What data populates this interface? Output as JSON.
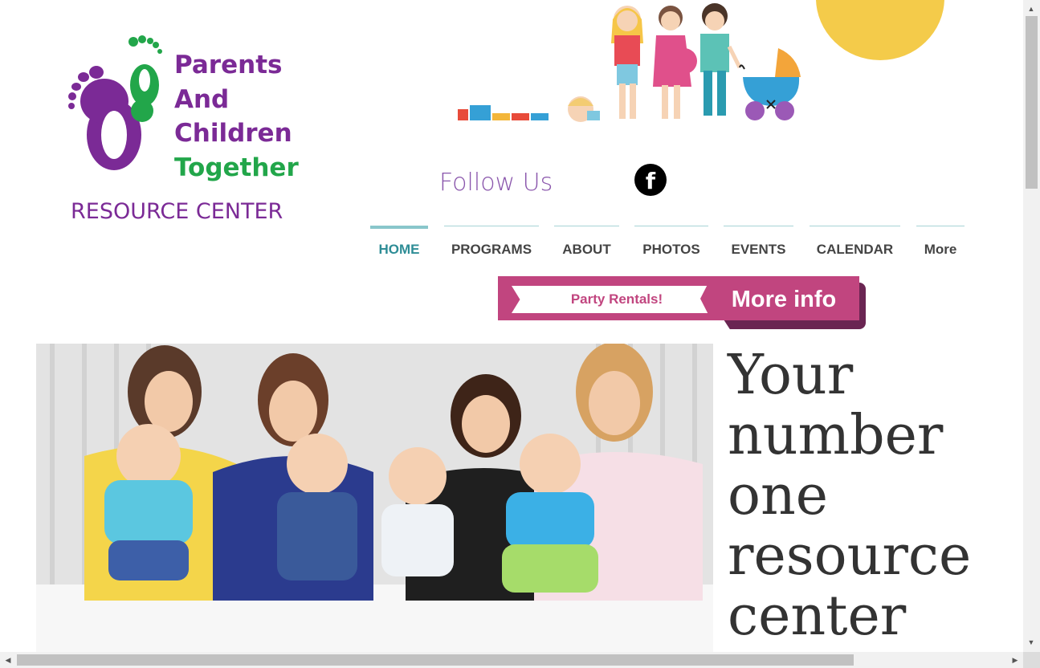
{
  "logo": {
    "line1": "Parents",
    "line2": "And",
    "line3": "Children",
    "line4": "Together",
    "line5": "RESOURCE CENTER",
    "icon": "footprints-icon"
  },
  "social": {
    "follow_label": "Follow Us",
    "facebook_glyph": "f",
    "facebook_icon": "facebook-icon"
  },
  "nav": {
    "items": [
      {
        "label": "HOME",
        "active": true
      },
      {
        "label": "PROGRAMS",
        "active": false
      },
      {
        "label": "ABOUT",
        "active": false
      },
      {
        "label": "PHOTOS",
        "active": false
      },
      {
        "label": "EVENTS",
        "active": false
      },
      {
        "label": "CALENDAR",
        "active": false
      },
      {
        "label": "More",
        "active": false
      }
    ]
  },
  "banner": {
    "left_text": "Party Rentals!",
    "right_text": "More info"
  },
  "hero": {
    "tagline": "Your number one resource center"
  },
  "scrollbar": {
    "up": "▲",
    "down": "▼",
    "left": "◀",
    "right": "▶"
  },
  "colors": {
    "brand_purple": "#7b2a96",
    "brand_green": "#22a64a",
    "nav_active": "#2e8d96",
    "banner_pink": "#c1457f",
    "sun_yellow": "#f4cb4a"
  }
}
